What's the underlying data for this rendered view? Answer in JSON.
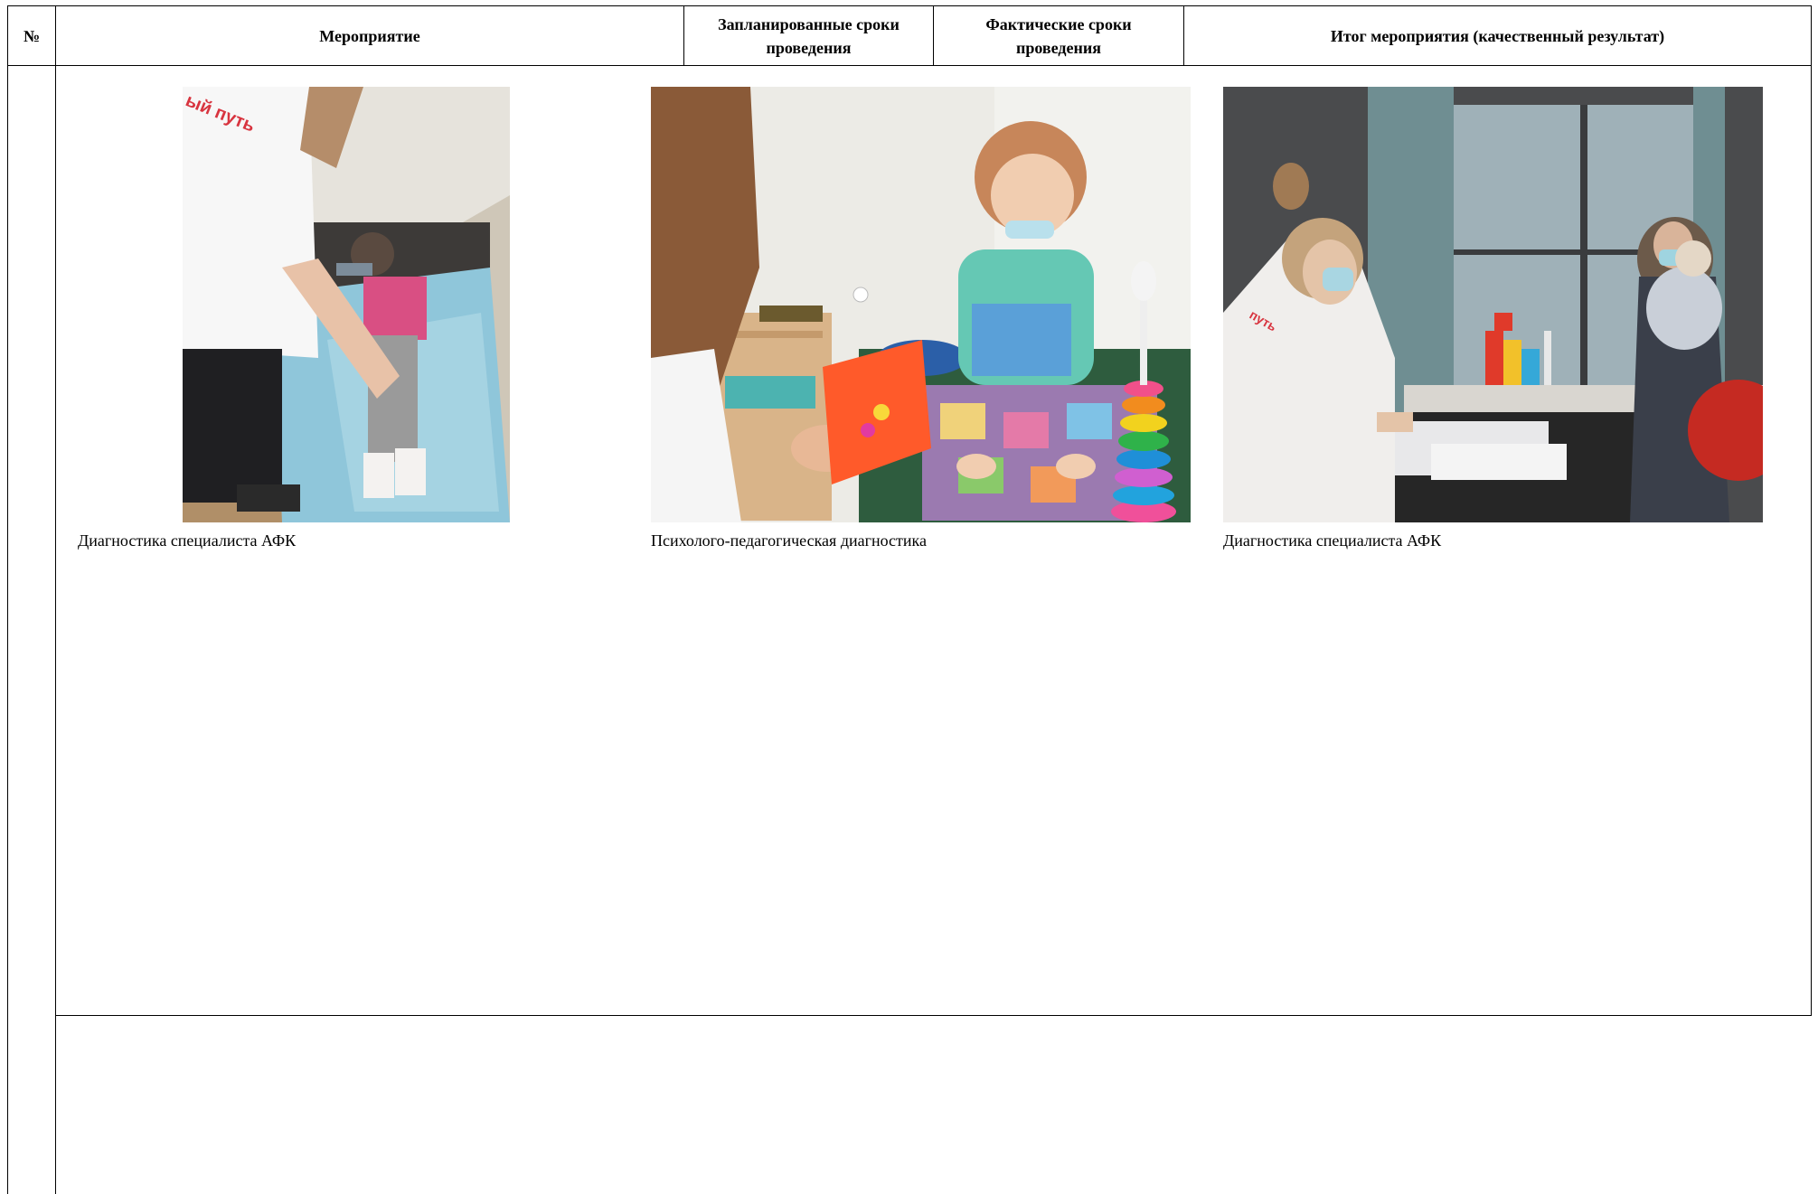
{
  "table": {
    "headers": {
      "number": "№",
      "event": "Мероприятие",
      "planned_dates": "Запланированные сроки проведения",
      "actual_dates": "Фактические сроки проведения",
      "result": "Итог мероприятия (качественный результат)"
    }
  },
  "photos": [
    {
      "caption": "Диагностика специалиста АФК",
      "shirt_text": "ый путь"
    },
    {
      "caption": "Психолого-педагогическая диагностика"
    },
    {
      "caption": "Диагностика специалиста АФК",
      "shirt_text": "путь"
    }
  ]
}
